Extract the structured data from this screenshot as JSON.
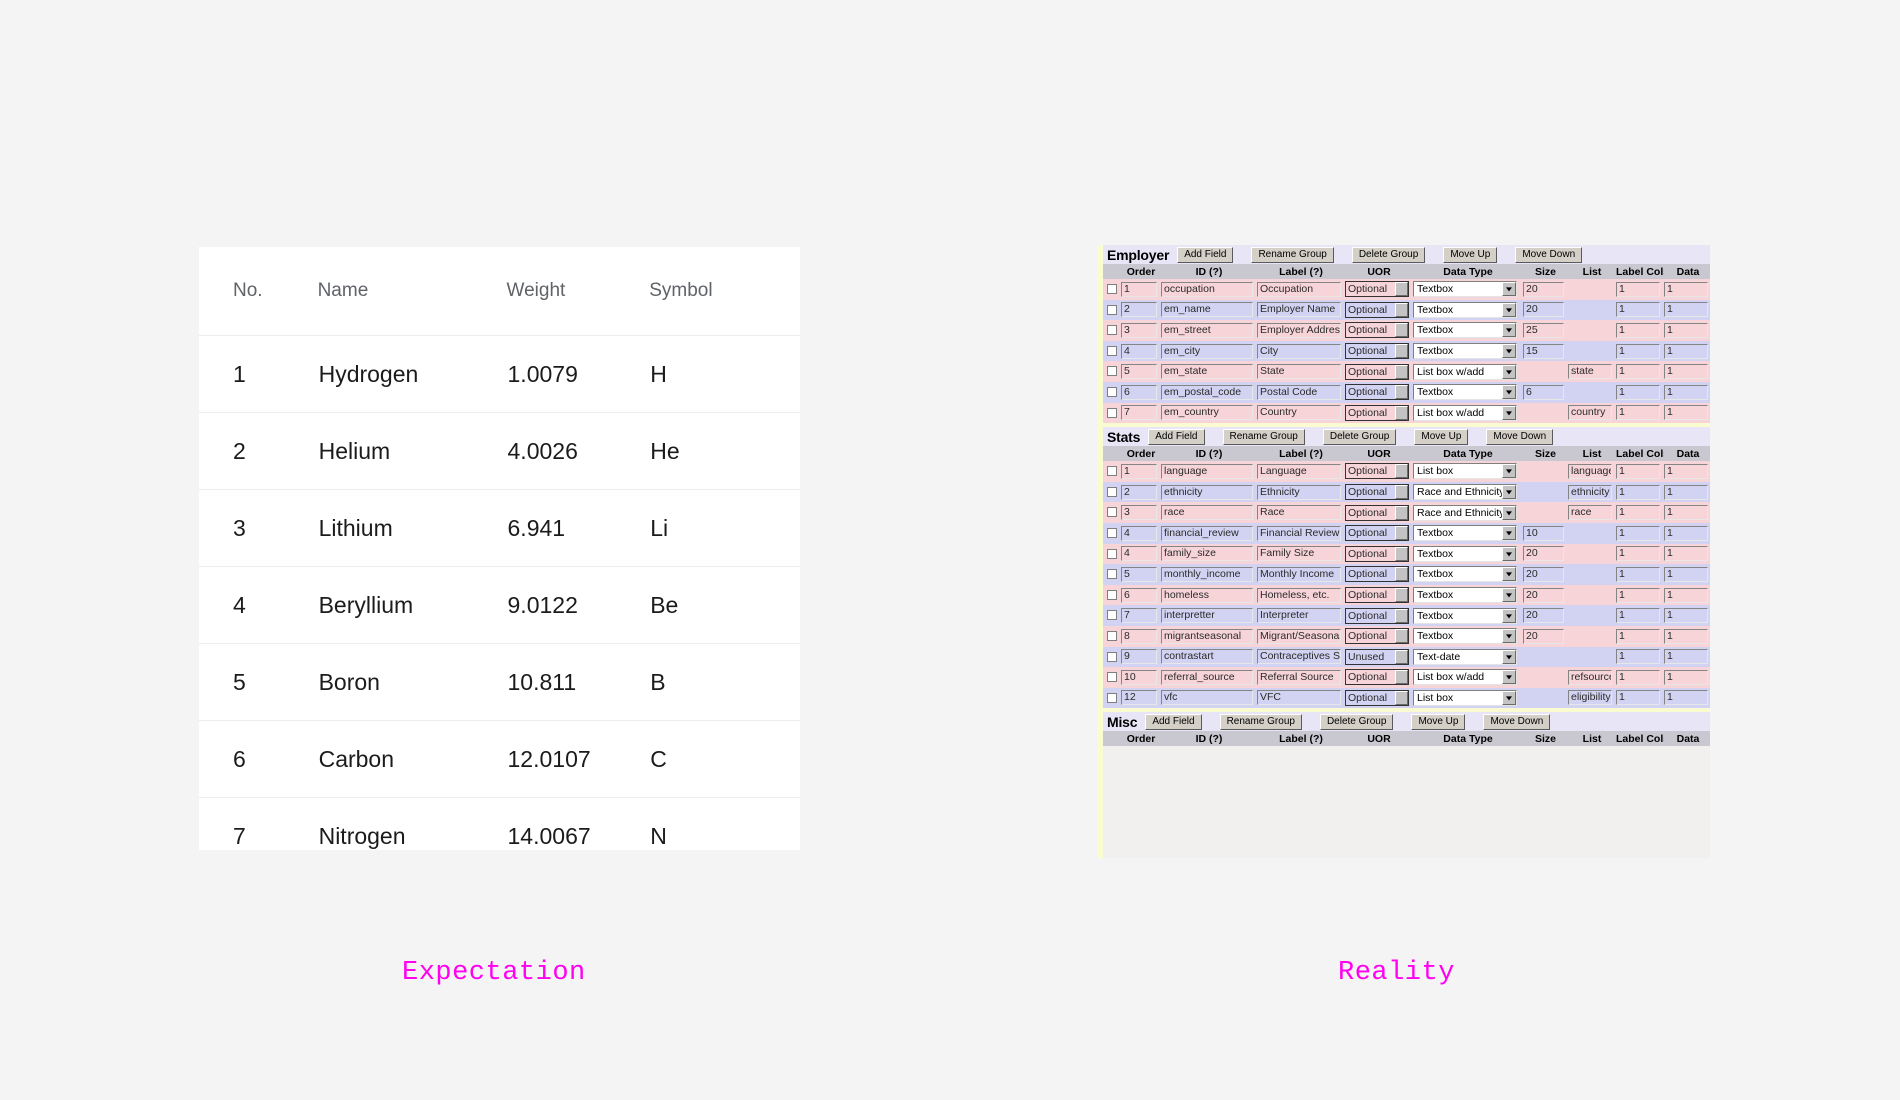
{
  "captions": {
    "left": "Expectation",
    "right": "Reality",
    "color": "#ff00f0"
  },
  "expectation": {
    "columns": [
      "No.",
      "Name",
      "Weight",
      "Symbol"
    ],
    "rows": [
      {
        "no": "1",
        "name": "Hydrogen",
        "weight": "1.0079",
        "symbol": "H"
      },
      {
        "no": "2",
        "name": "Helium",
        "weight": "4.0026",
        "symbol": "He"
      },
      {
        "no": "3",
        "name": "Lithium",
        "weight": "6.941",
        "symbol": "Li"
      },
      {
        "no": "4",
        "name": "Beryllium",
        "weight": "9.0122",
        "symbol": "Be"
      },
      {
        "no": "5",
        "name": "Boron",
        "weight": "10.811",
        "symbol": "B"
      },
      {
        "no": "6",
        "name": "Carbon",
        "weight": "12.0107",
        "symbol": "C"
      },
      {
        "no": "7",
        "name": "Nitrogen",
        "weight": "14.0067",
        "symbol": "N"
      }
    ]
  },
  "reality": {
    "group_buttons": [
      "Add Field",
      "Rename Group",
      "Delete Group",
      "Move Up",
      "Move Down"
    ],
    "column_headers": [
      "Order",
      "ID (?)",
      "Label (?)",
      "UOR",
      "Data Type",
      "Size",
      "List",
      "Label Cols",
      "Data"
    ],
    "colors": {
      "group_band": "#fbfbd2",
      "group_header_bar": "#e8e6f6",
      "column_header_bar": "#c9c7cf",
      "row_odd": "#f7d4d8",
      "row_even": "#d2d2f2",
      "button_face": "#d4d0c8"
    },
    "groups": [
      {
        "title": "Employer",
        "fields": [
          {
            "order": "1",
            "id": "occupation",
            "label": "Occupation",
            "uor": "Optional",
            "type": "Textbox",
            "size": "20",
            "list": "",
            "label_cols": "1",
            "data_cols": "1"
          },
          {
            "order": "2",
            "id": "em_name",
            "label": "Employer Name",
            "uor": "Optional",
            "type": "Textbox",
            "size": "20",
            "list": "",
            "label_cols": "1",
            "data_cols": "1"
          },
          {
            "order": "3",
            "id": "em_street",
            "label": "Employer Address",
            "uor": "Optional",
            "type": "Textbox",
            "size": "25",
            "list": "",
            "label_cols": "1",
            "data_cols": "1"
          },
          {
            "order": "4",
            "id": "em_city",
            "label": "City",
            "uor": "Optional",
            "type": "Textbox",
            "size": "15",
            "list": "",
            "label_cols": "1",
            "data_cols": "1"
          },
          {
            "order": "5",
            "id": "em_state",
            "label": "State",
            "uor": "Optional",
            "type": "List box w/add",
            "size": "",
            "list": "state",
            "label_cols": "1",
            "data_cols": "1"
          },
          {
            "order": "6",
            "id": "em_postal_code",
            "label": "Postal Code",
            "uor": "Optional",
            "type": "Textbox",
            "size": "6",
            "list": "",
            "label_cols": "1",
            "data_cols": "1"
          },
          {
            "order": "7",
            "id": "em_country",
            "label": "Country",
            "uor": "Optional",
            "type": "List box w/add",
            "size": "",
            "list": "country",
            "label_cols": "1",
            "data_cols": "1"
          }
        ]
      },
      {
        "title": "Stats",
        "fields": [
          {
            "order": "1",
            "id": "language",
            "label": "Language",
            "uor": "Optional",
            "type": "List box",
            "size": "",
            "list": "language",
            "label_cols": "1",
            "data_cols": "1"
          },
          {
            "order": "2",
            "id": "ethnicity",
            "label": "Ethnicity",
            "uor": "Optional",
            "type": "Race and Ethnicity",
            "size": "",
            "list": "ethnicity",
            "label_cols": "1",
            "data_cols": "1"
          },
          {
            "order": "3",
            "id": "race",
            "label": "Race",
            "uor": "Optional",
            "type": "Race and Ethnicity",
            "size": "",
            "list": "race",
            "label_cols": "1",
            "data_cols": "1"
          },
          {
            "order": "4",
            "id": "financial_review",
            "label": "Financial Review D",
            "uor": "Optional",
            "type": "Textbox",
            "size": "10",
            "list": "",
            "label_cols": "1",
            "data_cols": "1"
          },
          {
            "order": "4",
            "id": "family_size",
            "label": "Family Size",
            "uor": "Optional",
            "type": "Textbox",
            "size": "20",
            "list": "",
            "label_cols": "1",
            "data_cols": "1"
          },
          {
            "order": "5",
            "id": "monthly_income",
            "label": "Monthly Income",
            "uor": "Optional",
            "type": "Textbox",
            "size": "20",
            "list": "",
            "label_cols": "1",
            "data_cols": "1"
          },
          {
            "order": "6",
            "id": "homeless",
            "label": "Homeless, etc.",
            "uor": "Optional",
            "type": "Textbox",
            "size": "20",
            "list": "",
            "label_cols": "1",
            "data_cols": "1"
          },
          {
            "order": "7",
            "id": "interpretter",
            "label": "Interpreter",
            "uor": "Optional",
            "type": "Textbox",
            "size": "20",
            "list": "",
            "label_cols": "1",
            "data_cols": "1"
          },
          {
            "order": "8",
            "id": "migrantseasonal",
            "label": "Migrant/Seasonal",
            "uor": "Optional",
            "type": "Textbox",
            "size": "20",
            "list": "",
            "label_cols": "1",
            "data_cols": "1"
          },
          {
            "order": "9",
            "id": "contrastart",
            "label": "Contraceptives Sta",
            "uor": "Unused",
            "type": "Text-date",
            "size": "",
            "list": "",
            "label_cols": "1",
            "data_cols": "1"
          },
          {
            "order": "10",
            "id": "referral_source",
            "label": "Referral Source",
            "uor": "Optional",
            "type": "List box w/add",
            "size": "",
            "list": "refsource",
            "label_cols": "1",
            "data_cols": "1"
          },
          {
            "order": "12",
            "id": "vfc",
            "label": "VFC",
            "uor": "Optional",
            "type": "List box",
            "size": "",
            "list": "eligibility",
            "label_cols": "1",
            "data_cols": "1"
          }
        ]
      },
      {
        "title": "Misc",
        "fields": []
      }
    ]
  }
}
